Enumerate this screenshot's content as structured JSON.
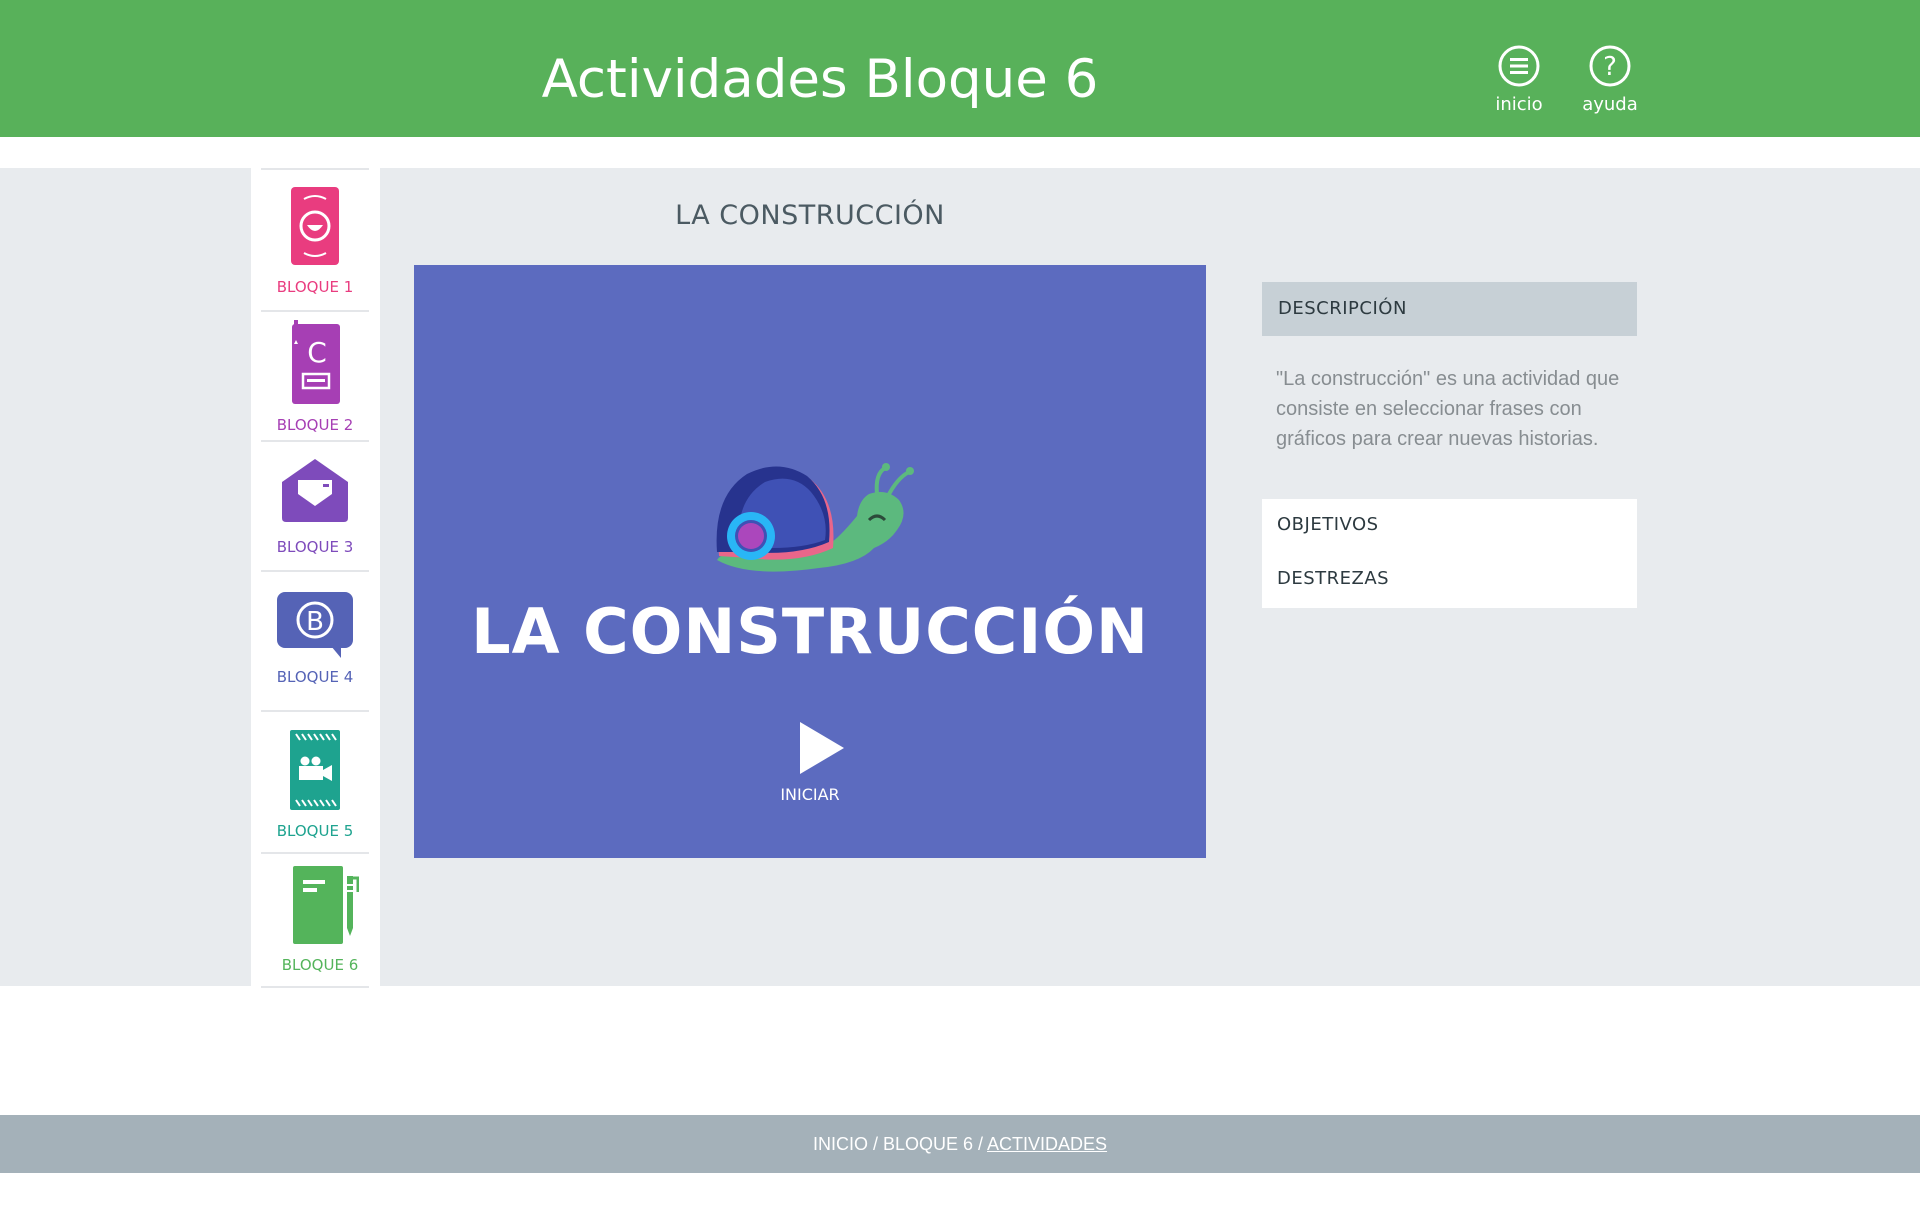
{
  "header": {
    "title": "Actividades Bloque 6",
    "buttons": [
      {
        "label": "inicio",
        "icon": "menu-icon"
      },
      {
        "label": "ayuda",
        "icon": "help-icon"
      }
    ]
  },
  "sidebar": {
    "items": [
      {
        "label": "BLOQUE 1",
        "color": "#e93c7f",
        "icon": "smiley-card-icon"
      },
      {
        "label": "BLOQUE 2",
        "color": "#a63fb4",
        "icon": "book-c-icon"
      },
      {
        "label": "BLOQUE 3",
        "color": "#7e4bbb",
        "icon": "envelope-heart-icon"
      },
      {
        "label": "BLOQUE 4",
        "color": "#5563b6",
        "icon": "speech-bubble-b-icon"
      },
      {
        "label": "BLOQUE 5",
        "color": "#1ea38f",
        "icon": "film-camera-icon"
      },
      {
        "label": "BLOQUE 6",
        "color": "#54b45b",
        "icon": "notebook-pen-icon"
      }
    ]
  },
  "main": {
    "section_title": "LA CONSTRUCCIÓN",
    "activity": {
      "title": "LA CONSTRUCCIÓN",
      "start_label": "INICIAR",
      "background": "#5c6bbf",
      "mascot_icon": "snail-icon",
      "play_icon": "play-icon"
    }
  },
  "info": {
    "description_header": "DESCRIPCIÓN",
    "description_text": "\"La construcción\" es una actividad que consiste en seleccionar frases con gráficos para crear nuevas historias.",
    "links": [
      "OBJETIVOS",
      "DESTREZAS"
    ]
  },
  "footer": {
    "breadcrumb": {
      "part1": "INICIO",
      "sep1": " / ",
      "part2": "BLOQUE 6",
      "sep2": " / ",
      "current": "ACTIVIDADES"
    }
  },
  "colors": {
    "header": "#58b15a",
    "main_bg": "#e8ebee",
    "footer": "#a4b1b9"
  }
}
